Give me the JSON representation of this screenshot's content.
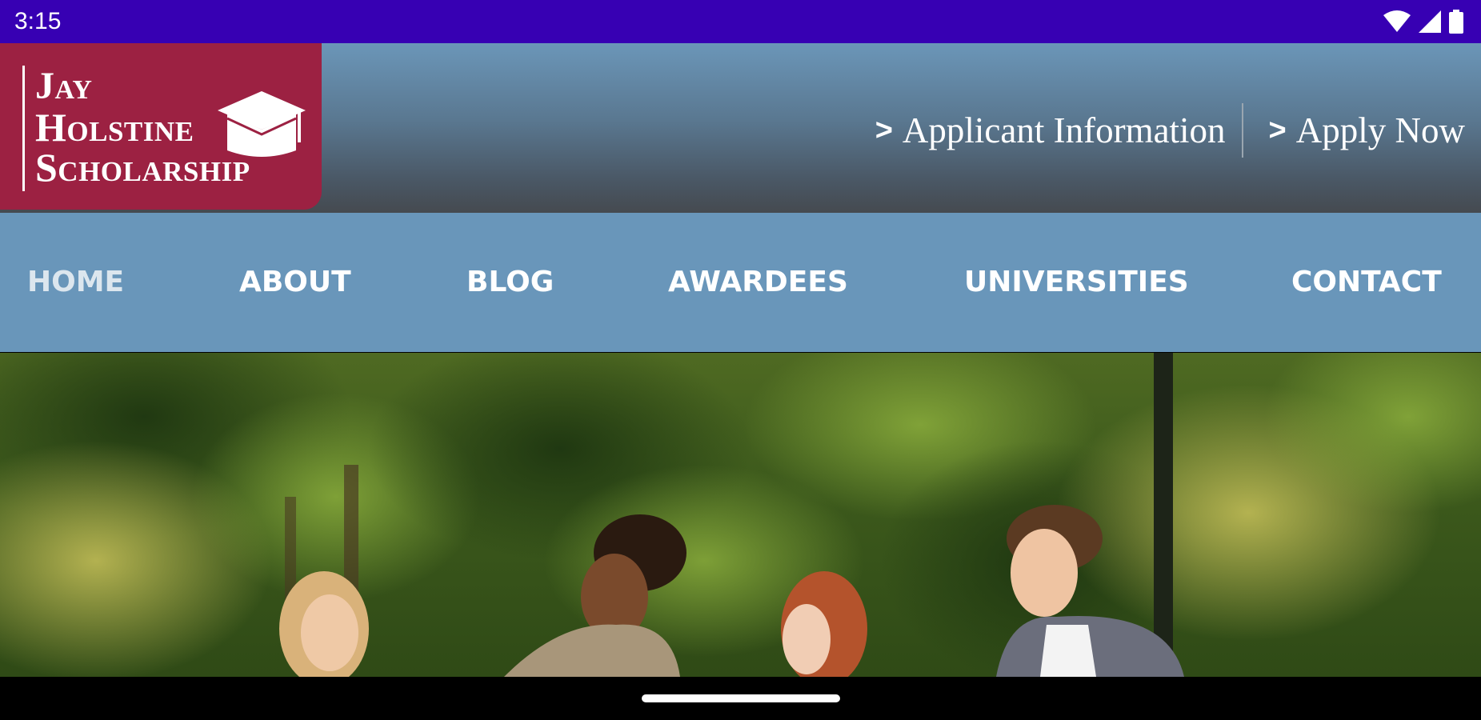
{
  "status_bar": {
    "time": "3:15",
    "icons": [
      "wifi-icon",
      "signal-icon",
      "battery-icon"
    ],
    "background": "#3700b3"
  },
  "header": {
    "logo": {
      "lines": [
        "Jay",
        "Holstine",
        "Scholarship"
      ],
      "icon": "graduation-cap-icon",
      "background": "#9c2142"
    },
    "links": [
      {
        "chevron": ">",
        "label": "Applicant Information"
      },
      {
        "chevron": ">",
        "label": "Apply Now"
      }
    ]
  },
  "nav": {
    "background": "#6996ba",
    "items": [
      {
        "label": "HOME",
        "active": true
      },
      {
        "label": "ABOUT"
      },
      {
        "label": "BLOG"
      },
      {
        "label": "AWARDEES"
      },
      {
        "label": "UNIVERSITIES"
      },
      {
        "label": "CONTACT"
      }
    ]
  },
  "hero": {
    "image": "students-walking-in-park-photo"
  }
}
